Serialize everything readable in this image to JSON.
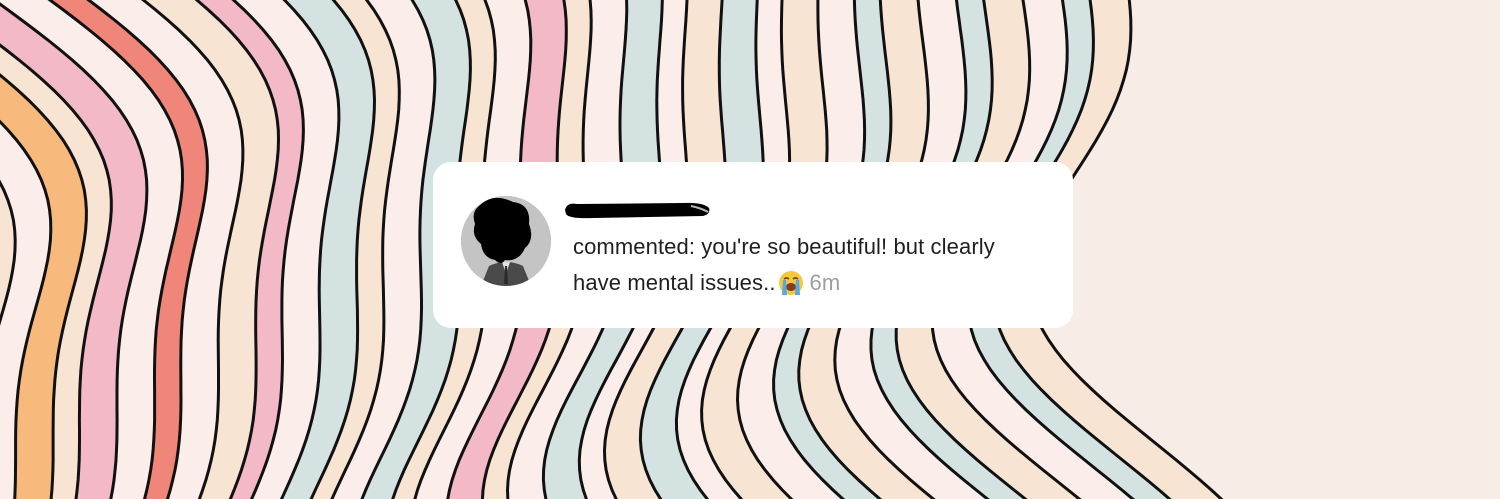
{
  "notification": {
    "username": "redacted",
    "comment_line1": "commented: you're so beautiful! but clearly",
    "comment_line2": "have mental issues..",
    "emoji": "loudly-crying-face",
    "time": "6m"
  },
  "colors": {
    "card_background": "#ffffff",
    "comment_text": "#1f1f1f",
    "time_text": "#9e9e9e",
    "stripe_palette": [
      "#f8b97d",
      "#f0867a",
      "#f3b9c7",
      "#d4e3e2",
      "#f8e4d2",
      "#fbeeea"
    ]
  }
}
